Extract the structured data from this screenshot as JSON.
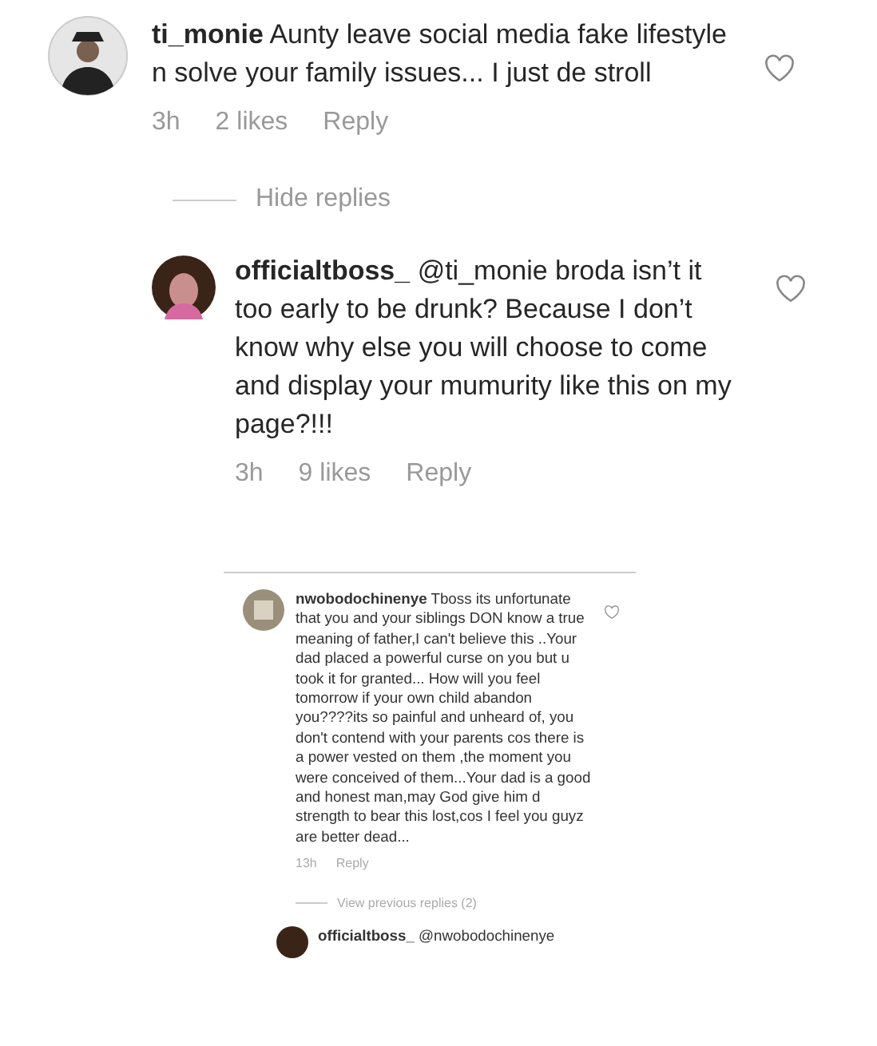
{
  "comment": {
    "username": "ti_monie",
    "text": "Aunty leave social media fake lifestyle n solve your family issues... I just de stroll",
    "time": "3h",
    "likes": "2 likes",
    "reply_label": "Reply",
    "liked": false
  },
  "hide_replies": "Hide replies",
  "reply": {
    "username": "officialtboss_",
    "text": "@ti_monie broda isn’t it too early to be drunk? Because I don’t know why else you will choose to come and display your mumurity like this on my page?!!!",
    "time": "3h",
    "likes": "9 likes",
    "reply_label": "Reply",
    "liked": false
  },
  "embedded_screenshot": {
    "comment": {
      "username": "nwobodochinenye",
      "text": "Tboss its unfortunate that you and your siblings DON know a true meaning of father,I can't believe this ..Your dad placed a powerful curse on you but u took it for granted... How will you feel tomorrow if your own child abandon you????its so painful and unheard of, you don't contend with your parents cos there is a power vested on them ,the moment you were conceived of them...Your dad is a good and honest man,may God give him d strength to bear this lost,cos I feel you guyz are better dead...",
      "time": "13h",
      "reply_label": "Reply",
      "liked": false
    },
    "view_previous": "View previous replies (2)",
    "next_comment": {
      "username": "officialtboss_",
      "text": "@nwobodochinenye"
    }
  }
}
